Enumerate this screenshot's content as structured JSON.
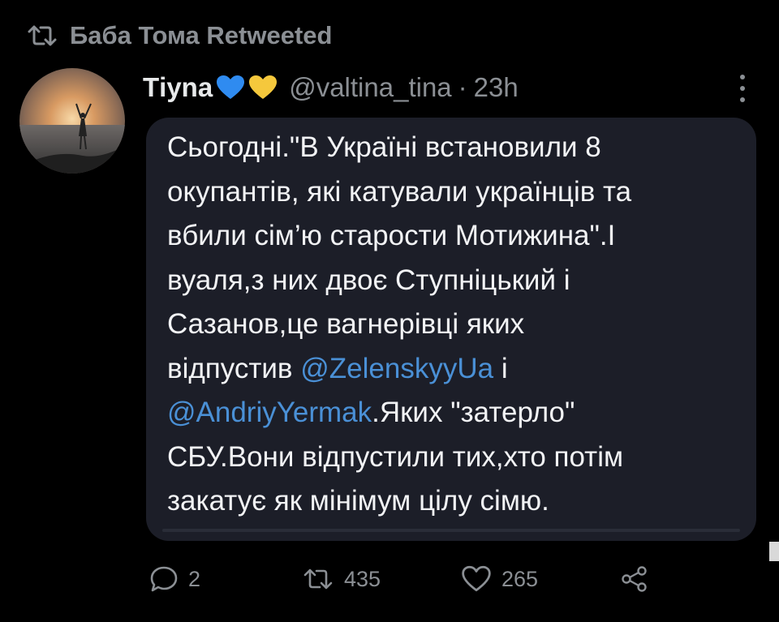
{
  "retweet": {
    "icon": "retweet-icon",
    "text": "Баба Тома Retweeted"
  },
  "tweet": {
    "author_name": "Тіуna",
    "author_emojis": [
      "blue-heart-icon",
      "yellow-heart-icon"
    ],
    "handle": "@valtina_tina",
    "separator": "·",
    "time": "23h",
    "text_segments": [
      {
        "type": "text",
        "value": "Сьогодні.\"В Україні встановили 8\nокупантів, які катували українців та\nвбили сім’ю старости Мотижина\".І\nвуаля,з них двоє Ступніцький і\nСазанов,це вагнерівці яких\nвідпустив "
      },
      {
        "type": "mention",
        "value": "@ZelenskyyUa"
      },
      {
        "type": "text",
        "value": " і\n"
      },
      {
        "type": "mention",
        "value": "@AndriyYermak"
      },
      {
        "type": "text",
        "value": ".Яких \"затерло\"\nСБУ.Вони відпустили тих,хто потім\nзакатує як мінімум цілу сімю."
      }
    ],
    "actions": {
      "reply_count": "2",
      "retweet_count": "435",
      "like_count": "265"
    }
  },
  "colors": {
    "background": "#000000",
    "bubble": "#1c1e28",
    "muted": "#8b8f94",
    "mention": "#4a90d6",
    "heart_blue": "#2f8bf0",
    "heart_yellow": "#f5c83c"
  }
}
